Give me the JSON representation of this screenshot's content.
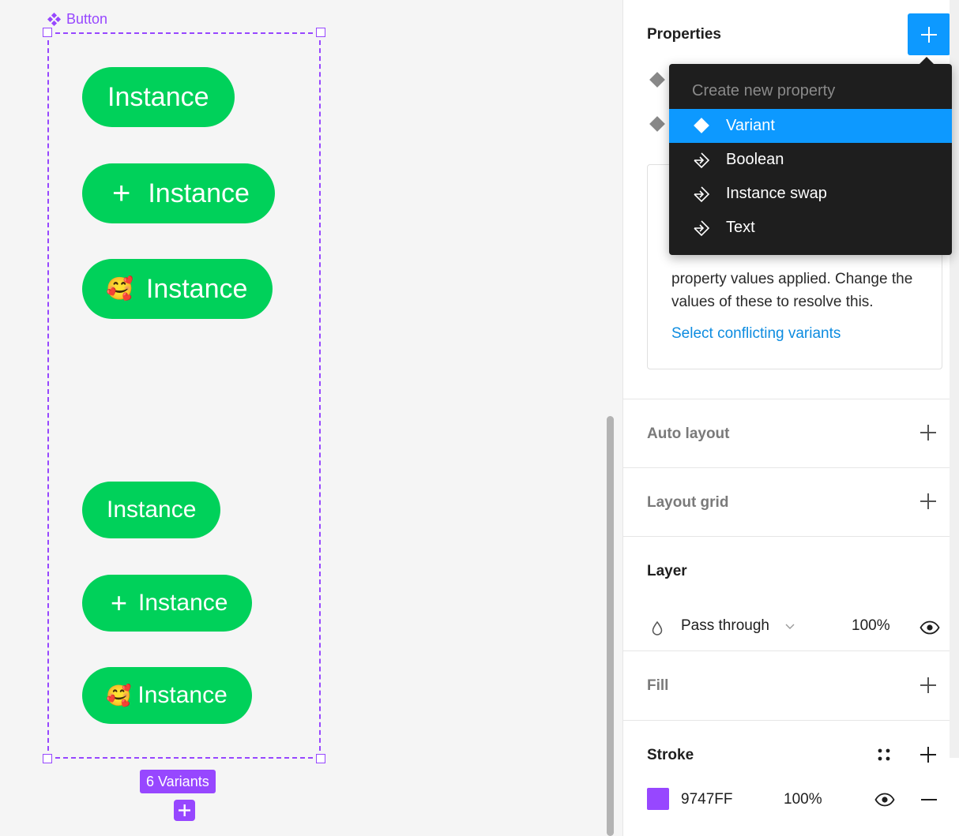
{
  "canvas": {
    "frame_label": "Button",
    "buttons": [
      {
        "label": "Instance",
        "prefix": ""
      },
      {
        "label": "Instance",
        "prefix": "+"
      },
      {
        "label": "Instance",
        "prefix": "🥰"
      },
      {
        "label": "Instance",
        "prefix": ""
      },
      {
        "label": "Instance",
        "prefix": "+"
      },
      {
        "label": "Instance",
        "prefix": "🥰"
      }
    ],
    "variants_badge": "6 Variants",
    "accent_color": "#9747ff",
    "button_color": "#00d15a"
  },
  "panel": {
    "properties": {
      "title": "Properties",
      "warning_text": "property values applied. Change the values of these to resolve this.",
      "warning_link": "Select conflicting variants"
    },
    "dropdown": {
      "header": "Create new property",
      "items": [
        {
          "label": "Variant",
          "icon": "diamond-icon",
          "active": true
        },
        {
          "label": "Boolean",
          "icon": "property-icon",
          "active": false
        },
        {
          "label": "Instance swap",
          "icon": "property-icon",
          "active": false
        },
        {
          "label": "Text",
          "icon": "property-icon",
          "active": false
        }
      ]
    },
    "auto_layout": {
      "title": "Auto layout"
    },
    "layout_grid": {
      "title": "Layout grid"
    },
    "layer": {
      "title": "Layer",
      "blend_mode": "Pass through",
      "opacity": "100%"
    },
    "fill": {
      "title": "Fill"
    },
    "stroke": {
      "title": "Stroke",
      "color_hex": "9747FF",
      "opacity": "100%",
      "swatch_color": "#9747ff"
    },
    "primary_color": "#0d99ff"
  }
}
